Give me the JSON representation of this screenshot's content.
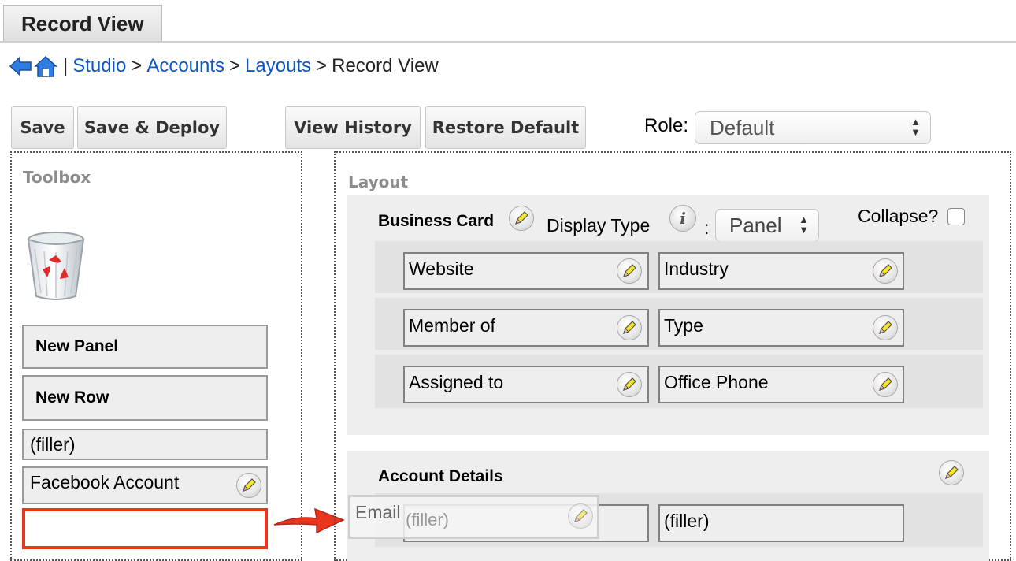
{
  "tab": {
    "label": "Record View"
  },
  "breadcrumb": {
    "divider": "|",
    "links": [
      "Studio",
      "Accounts",
      "Layouts"
    ],
    "separator": ">",
    "current": "Record View"
  },
  "toolbar": {
    "save": "Save",
    "save_deploy": "Save & Deploy",
    "view_history": "View History",
    "restore_default": "Restore Default",
    "role_label": "Role:",
    "role_value": "Default"
  },
  "toolbox": {
    "title": "Toolbox",
    "new_panel": "New Panel",
    "new_row": "New Row",
    "filler": "(filler)",
    "facebook": "Facebook Account"
  },
  "layout": {
    "title": "Layout",
    "business_card": {
      "name": "Business Card",
      "display_type_label": "Display Type",
      "colon": ":",
      "display_type_value": "Panel",
      "collapse_label": "Collapse?",
      "rows": [
        {
          "left": "Website",
          "right": "Industry"
        },
        {
          "left": "Member of",
          "right": "Type"
        },
        {
          "left": "Assigned to",
          "right": "Office Phone"
        }
      ]
    },
    "account_details": {
      "name": "Account Details",
      "rows": [
        {
          "left": "",
          "right": "(filler)"
        }
      ]
    },
    "drag_ghost": {
      "label": "Email",
      "underlying": "(filler)"
    }
  },
  "colors": {
    "link": "#0b57c8",
    "highlight": "#e8351c",
    "arrow": "#e8351c"
  }
}
